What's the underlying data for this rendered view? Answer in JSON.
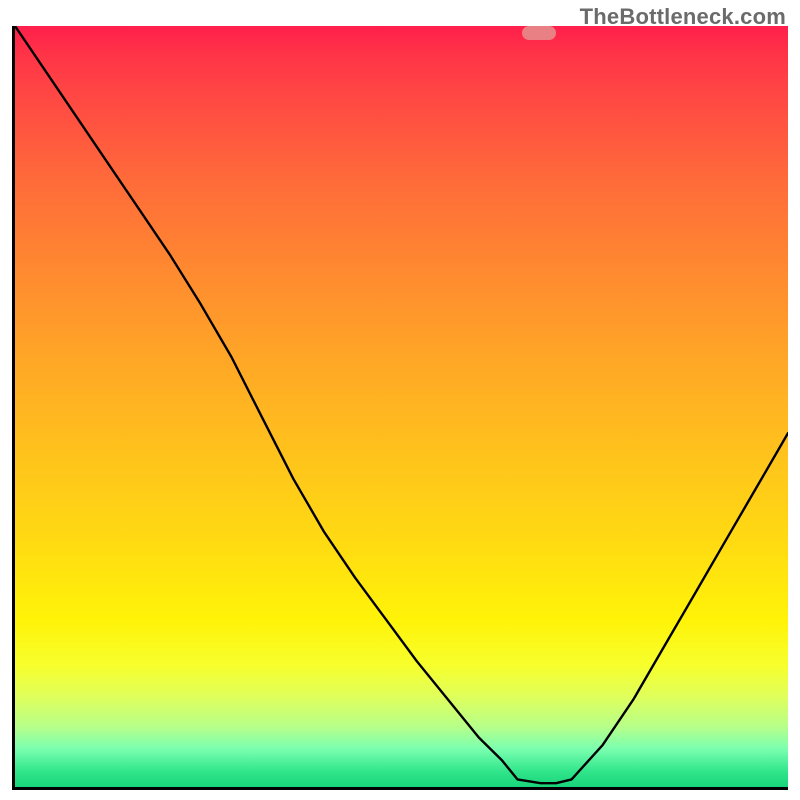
{
  "watermark": "TheBottleneck.com",
  "marker": {
    "x_frac": 0.675,
    "y_frac": 0.992
  },
  "chart_data": {
    "type": "line",
    "title": "",
    "xlabel": "",
    "ylabel": "",
    "xlim": [
      0,
      1
    ],
    "ylim": [
      0,
      1
    ],
    "x": [
      0.0,
      0.05,
      0.1,
      0.15,
      0.2,
      0.24,
      0.28,
      0.32,
      0.36,
      0.4,
      0.44,
      0.48,
      0.52,
      0.56,
      0.6,
      0.63,
      0.65,
      0.68,
      0.7,
      0.72,
      0.76,
      0.8,
      0.84,
      0.88,
      0.92,
      0.96,
      1.0
    ],
    "values": [
      1.0,
      0.925,
      0.85,
      0.775,
      0.7,
      0.635,
      0.565,
      0.485,
      0.405,
      0.335,
      0.275,
      0.22,
      0.165,
      0.115,
      0.065,
      0.035,
      0.01,
      0.005,
      0.005,
      0.01,
      0.055,
      0.115,
      0.185,
      0.255,
      0.325,
      0.395,
      0.465
    ],
    "note": "x and y are normalized fractions of the plot area (0 = left/bottom, 1 = right/top); no numeric axis ticks are shown in the image"
  }
}
